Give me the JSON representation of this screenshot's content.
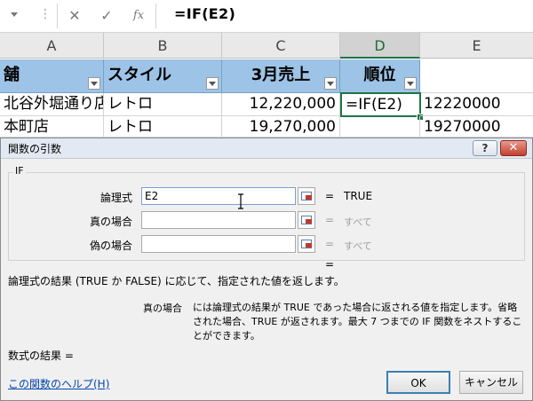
{
  "formula_bar": {
    "dots": "⋮",
    "cancel_glyph": "✕",
    "enter_glyph": "✓",
    "fx_glyph": "fx",
    "formula": "=IF(E2)"
  },
  "columns": [
    "A",
    "B",
    "C",
    "D",
    "E"
  ],
  "active_column": "D",
  "header_row": {
    "A": "舗",
    "B": "スタイル",
    "C": "3月売上",
    "D": "順位"
  },
  "rows": [
    {
      "A": "北谷外堀通り店",
      "B": "レトロ",
      "C": "12,220,000",
      "D": "=IF(E2)",
      "E": "12220000"
    },
    {
      "A": "本町店",
      "B": "レトロ",
      "C": "19,270,000",
      "D": "",
      "E": "19270000"
    }
  ],
  "dialog": {
    "title": "関数の引数",
    "help_button": "?",
    "close_button": "✕",
    "function_name": "IF",
    "arguments": [
      {
        "label": "論理式",
        "value": "E2",
        "result": "TRUE"
      },
      {
        "label": "真の場合",
        "value": "",
        "result": "すべて"
      },
      {
        "label": "偽の場合",
        "value": "",
        "result": "すべて"
      }
    ],
    "equals": "=",
    "description": "論理式の結果 (TRUE か FALSE) に応じて、指定された値を返します。",
    "arg_help_name": "真の場合",
    "arg_help_text": "には論理式の結果が TRUE であった場合に返される値を指定します。省略された場合、TRUE が返されます。最大 7 つまでの IF 関数をネストすることができます。",
    "formula_result_label": "数式の結果 =",
    "help_link": "この関数のヘルプ(H)",
    "ok_label": "OK",
    "cancel_label": "キャンセル"
  },
  "colors": {
    "header_fill": "#9dc3e6",
    "selection": "#217346",
    "link": "#0645ad"
  }
}
